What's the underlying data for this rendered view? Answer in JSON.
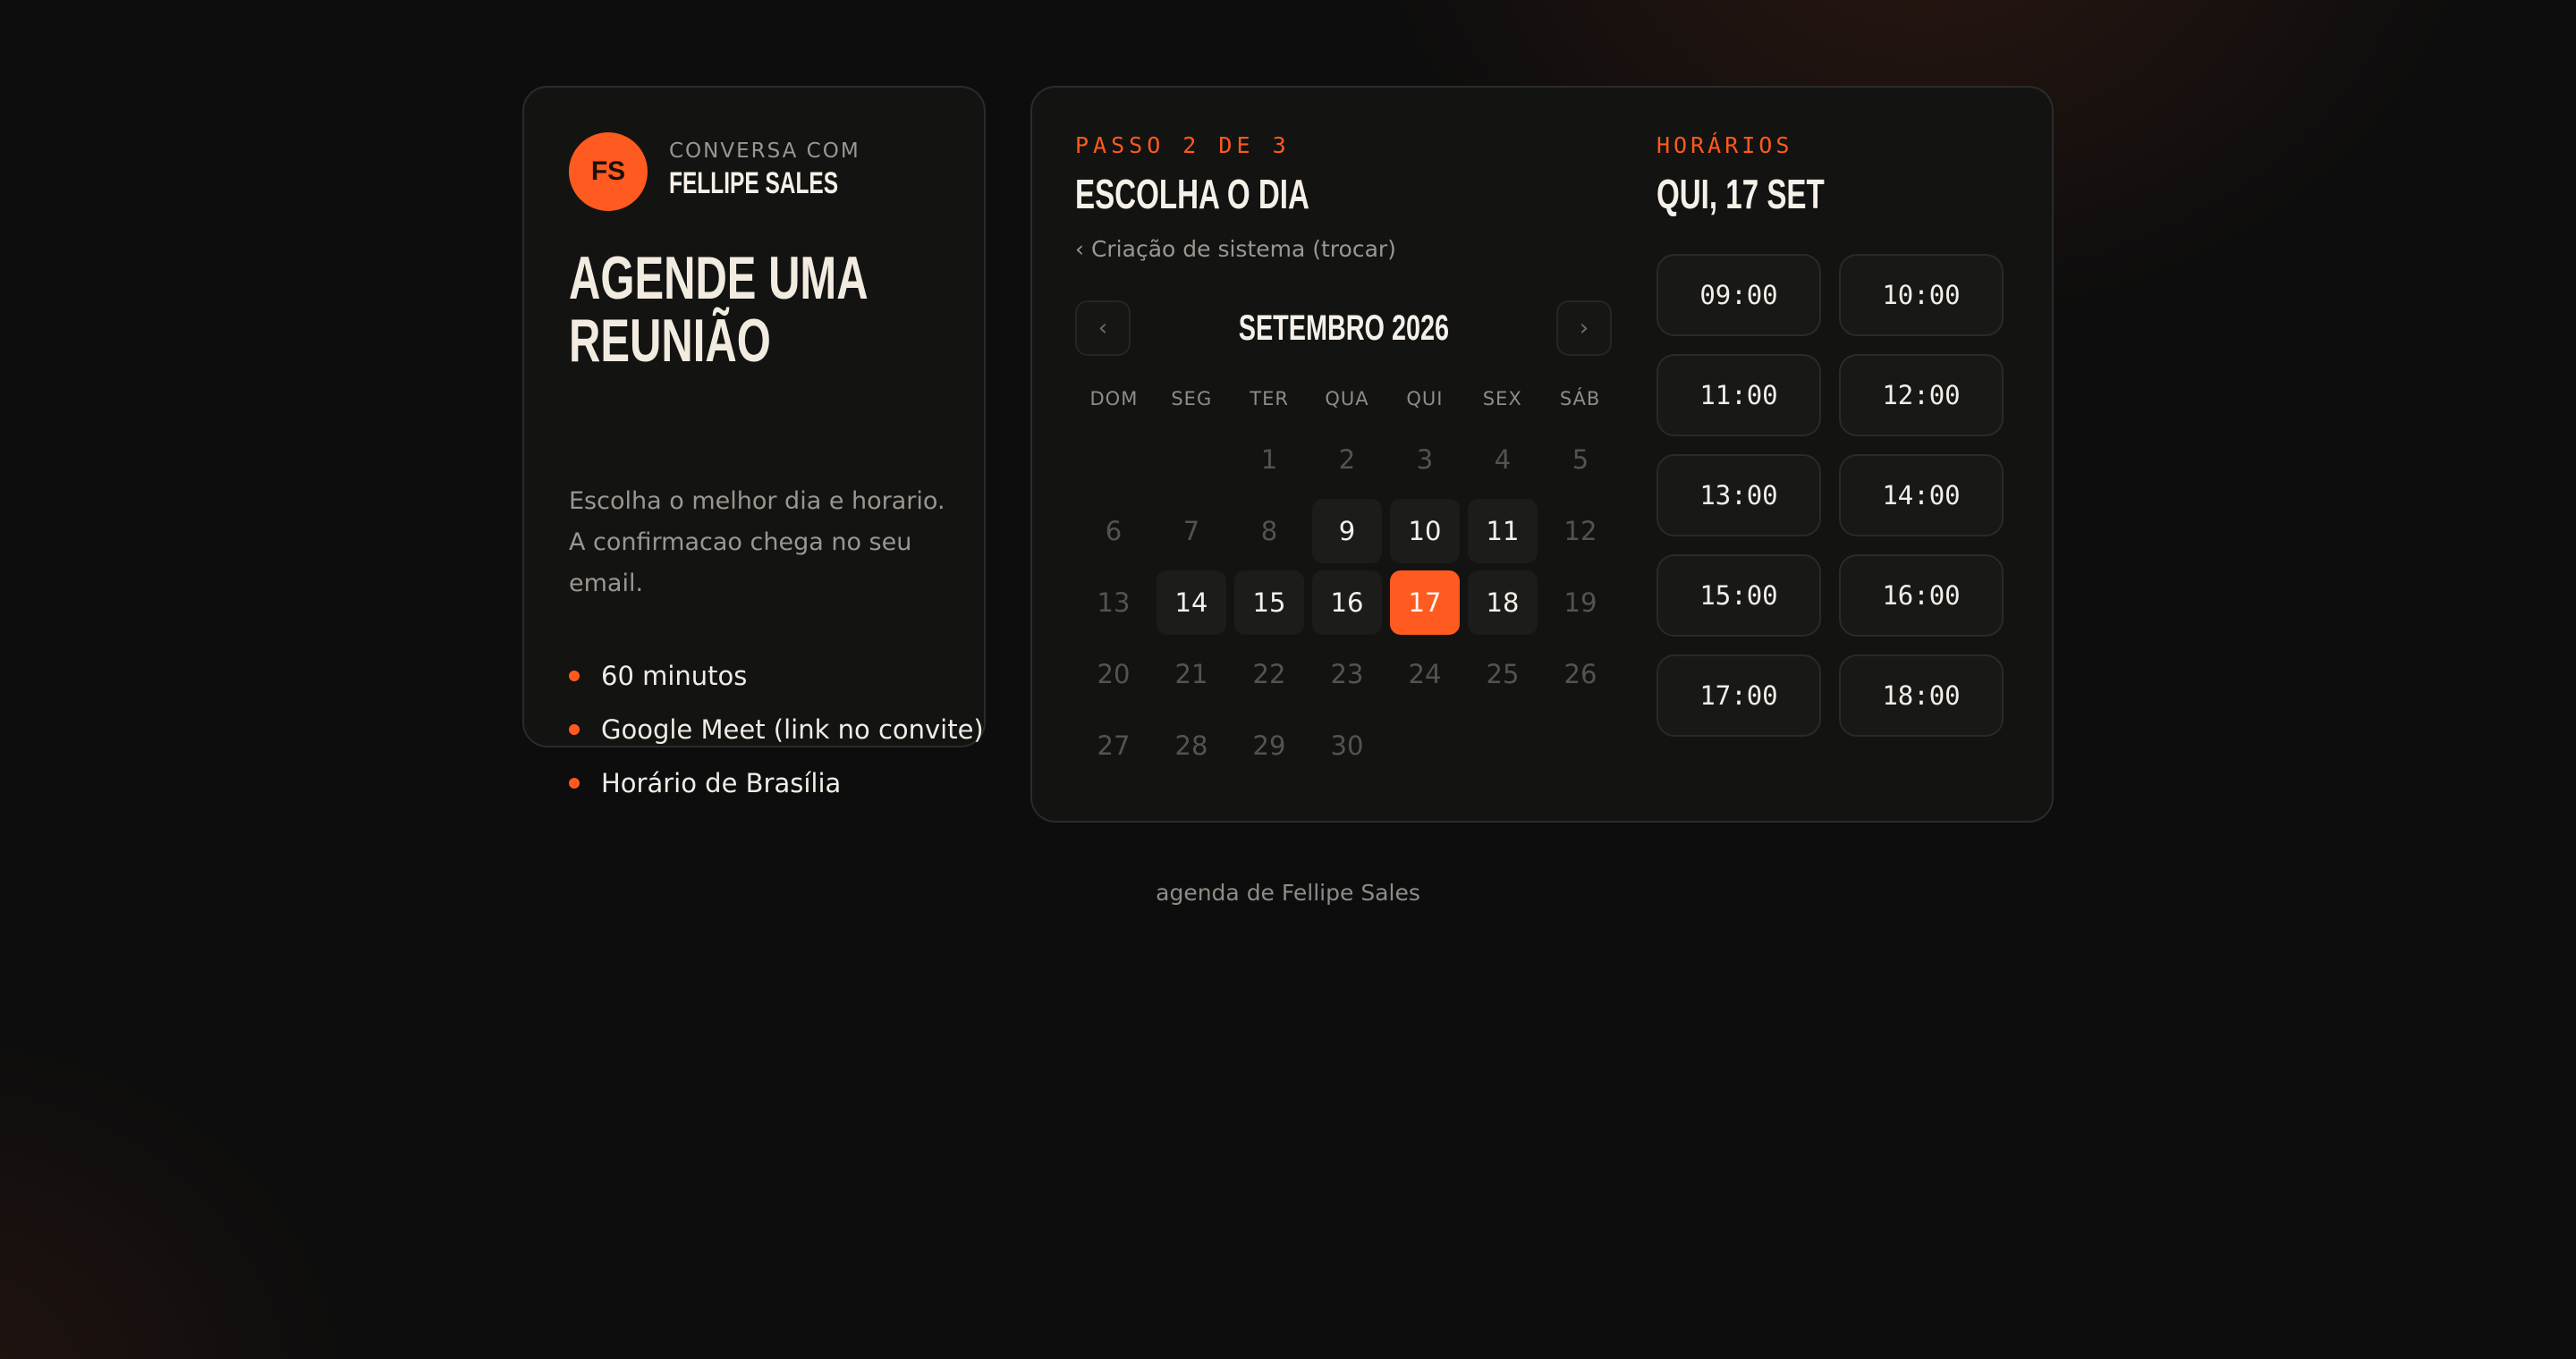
{
  "host": {
    "initials": "FS",
    "pre_label": "CONVERSA COM",
    "name": "FELLIPE SALES"
  },
  "intro": {
    "title_line1": "AGENDE UMA",
    "title_line2": "REUNIÃO",
    "description": "Escolha o melhor dia e horario. A confirmacao chega no seu email.",
    "features": [
      "60 minutos",
      "Google Meet (link no convite)",
      "Horário de Brasília"
    ]
  },
  "calendar": {
    "step_label": "PASSO 2 DE 3",
    "title": "ESCOLHA O DIA",
    "service_link": "‹ Criação de sistema (trocar)",
    "month_label": "SETEMBRO 2026",
    "prev_icon": "‹",
    "next_icon": "›",
    "weekdays": [
      "DOM",
      "SEG",
      "TER",
      "QUA",
      "QUI",
      "SEX",
      "SÁB"
    ],
    "days": [
      {
        "label": "",
        "state": "empty"
      },
      {
        "label": "",
        "state": "empty"
      },
      {
        "label": "1",
        "state": "disabled"
      },
      {
        "label": "2",
        "state": "disabled"
      },
      {
        "label": "3",
        "state": "disabled"
      },
      {
        "label": "4",
        "state": "disabled"
      },
      {
        "label": "5",
        "state": "disabled"
      },
      {
        "label": "6",
        "state": "disabled"
      },
      {
        "label": "7",
        "state": "disabled"
      },
      {
        "label": "8",
        "state": "disabled"
      },
      {
        "label": "9",
        "state": "available"
      },
      {
        "label": "10",
        "state": "available"
      },
      {
        "label": "11",
        "state": "available"
      },
      {
        "label": "12",
        "state": "disabled"
      },
      {
        "label": "13",
        "state": "disabled"
      },
      {
        "label": "14",
        "state": "available"
      },
      {
        "label": "15",
        "state": "available"
      },
      {
        "label": "16",
        "state": "available"
      },
      {
        "label": "17",
        "state": "selected"
      },
      {
        "label": "18",
        "state": "available"
      },
      {
        "label": "19",
        "state": "disabled"
      },
      {
        "label": "20",
        "state": "disabled"
      },
      {
        "label": "21",
        "state": "disabled"
      },
      {
        "label": "22",
        "state": "disabled"
      },
      {
        "label": "23",
        "state": "disabled"
      },
      {
        "label": "24",
        "state": "disabled"
      },
      {
        "label": "25",
        "state": "disabled"
      },
      {
        "label": "26",
        "state": "disabled"
      },
      {
        "label": "27",
        "state": "disabled"
      },
      {
        "label": "28",
        "state": "disabled"
      },
      {
        "label": "29",
        "state": "disabled"
      },
      {
        "label": "30",
        "state": "disabled"
      }
    ]
  },
  "times": {
    "label": "HORÁRIOS",
    "date_title": "QUI, 17 SET",
    "slots": [
      "09:00",
      "10:00",
      "11:00",
      "12:00",
      "13:00",
      "14:00",
      "15:00",
      "16:00",
      "17:00",
      "18:00"
    ]
  },
  "footer": {
    "text": "agenda de Fellipe Sales"
  },
  "colors": {
    "accent": "#ff5a1f",
    "background": "#0d0d0d",
    "card": "#131312"
  }
}
